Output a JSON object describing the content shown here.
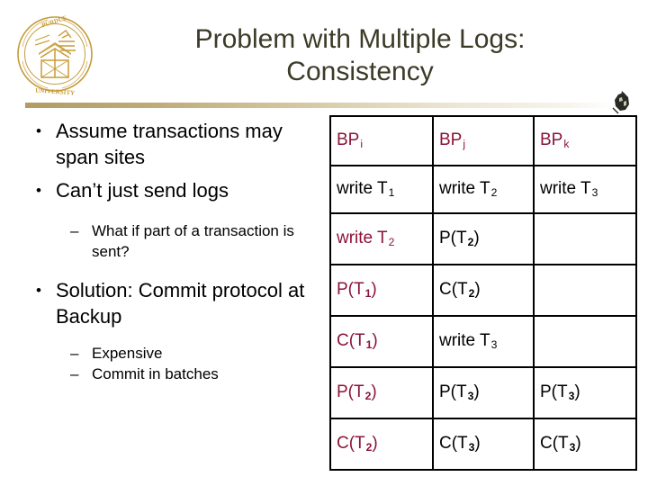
{
  "slide": {
    "background_color": "#ffffff",
    "title_color": "#3c3b28",
    "accent_color": "#8c1338",
    "divider_color": "#b29c63",
    "title_line1": "Problem with Multiple Logs:",
    "title_line2": "Consistency",
    "logo_name": "purdue-university-seal",
    "ornament_name": "corner-ornament"
  },
  "bullets": [
    {
      "level": 1,
      "text": "Assume transactions may span sites"
    },
    {
      "level": 1,
      "text": "Can’t just send logs"
    },
    {
      "level": 2,
      "text": "What if part of a transaction is sent?"
    },
    {
      "level": 1,
      "text": "Solution:  Commit protocol at Backup"
    },
    {
      "level": 2,
      "text": "Expensive"
    },
    {
      "level": 2,
      "text": "Commit in batches"
    }
  ],
  "table": {
    "headers": [
      {
        "base": "BP",
        "sub": "i",
        "color": "#8c1338"
      },
      {
        "base": "BP",
        "sub": "j",
        "color": "#8c1338"
      },
      {
        "base": "BP",
        "sub": "k",
        "color": "#8c1338"
      }
    ],
    "rows": [
      [
        {
          "base": "write T",
          "sub": "1",
          "color": "#000000"
        },
        {
          "base": "write T",
          "sub": "2",
          "color": "#000000"
        },
        {
          "base": "write T",
          "sub": "3",
          "color": "#000000"
        }
      ],
      [
        {
          "base": "write T",
          "sub": "2",
          "color": "#8c1338"
        },
        {
          "base": "P(T",
          "sub": "2",
          "tail": ")",
          "color": "#000000"
        },
        {
          "base": "",
          "sub": "",
          "color": "#000000"
        }
      ],
      [
        {
          "base": "P(T",
          "sub": "1",
          "tail": ")",
          "color": "#8c1338"
        },
        {
          "base": "C(T",
          "sub": "2",
          "tail": ")",
          "color": "#000000"
        },
        {
          "base": "",
          "sub": "",
          "color": "#000000"
        }
      ],
      [
        {
          "base": "C(T",
          "sub": "1",
          "tail": ")",
          "color": "#8c1338"
        },
        {
          "base": "write T",
          "sub": "3",
          "color": "#000000"
        },
        {
          "base": "",
          "sub": "",
          "color": "#000000"
        }
      ],
      [
        {
          "base": "P(T",
          "sub": "2",
          "tail": ")",
          "color": "#8c1338"
        },
        {
          "base": "P(T",
          "sub": "3",
          "tail": ")",
          "color": "#000000"
        },
        {
          "base": "P(T",
          "sub": "3",
          "tail": ")",
          "color": "#000000"
        }
      ],
      [
        {
          "base": "C(T",
          "sub": "2",
          "tail": ")",
          "color": "#8c1338"
        },
        {
          "base": "C(T",
          "sub": "3",
          "tail": ")",
          "color": "#000000"
        },
        {
          "base": "C(T",
          "sub": "3",
          "tail": ")",
          "color": "#000000"
        }
      ]
    ]
  }
}
